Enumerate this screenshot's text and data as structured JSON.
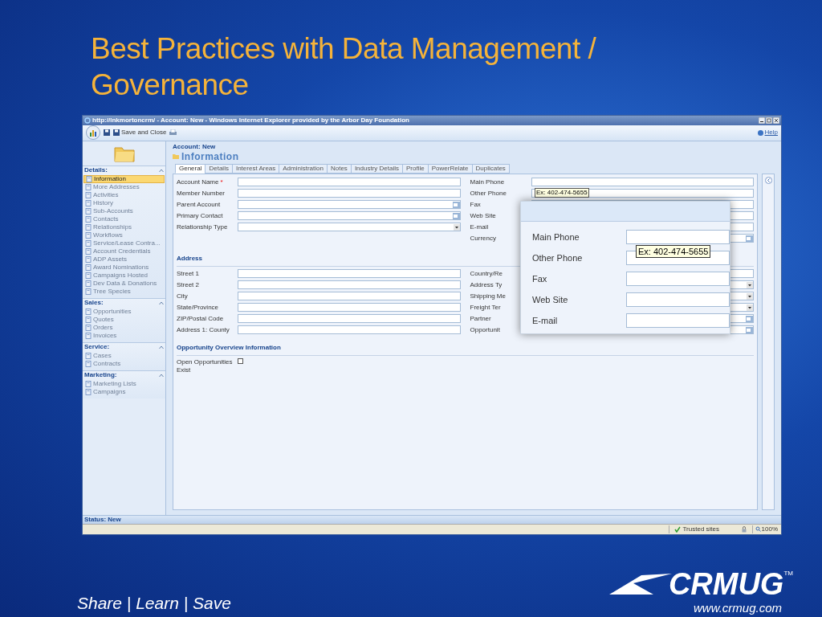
{
  "slide": {
    "title": "Best Practices with Data Management / Governance",
    "tagline": "Share | Learn | Save",
    "logo": {
      "name": "CRMUG",
      "trademark": "TM",
      "url": "www.crmug.com"
    }
  },
  "browser": {
    "title": "http://lnkmortoncrm/ - Account: New - Windows Internet Explorer provided by the Arbor Day Foundation",
    "toolbar": {
      "save_close": "Save and Close",
      "help": "Help"
    },
    "header": {
      "entity": "Account: New",
      "title": "Information"
    },
    "sidebar": [
      {
        "title": "Details:",
        "items": [
          {
            "label": "Information",
            "selected": true
          },
          {
            "label": "More Addresses",
            "selected": false
          },
          {
            "label": "Activities",
            "selected": false
          },
          {
            "label": "History",
            "selected": false
          },
          {
            "label": "Sub-Accounts",
            "selected": false
          },
          {
            "label": "Contacts",
            "selected": false
          },
          {
            "label": "Relationships",
            "selected": false
          },
          {
            "label": "Workflows",
            "selected": false
          },
          {
            "label": "Service/Lease Contra...",
            "selected": false
          },
          {
            "label": "Account Credentials",
            "selected": false
          },
          {
            "label": "ADP Assets",
            "selected": false
          },
          {
            "label": "Award Nominations",
            "selected": false
          },
          {
            "label": "Campaigns Hosted",
            "selected": false
          },
          {
            "label": "Dev Data & Donations",
            "selected": false
          },
          {
            "label": "Tree Species",
            "selected": false
          }
        ]
      },
      {
        "title": "Sales:",
        "items": [
          {
            "label": "Opportunities",
            "selected": false
          },
          {
            "label": "Quotes",
            "selected": false
          },
          {
            "label": "Orders",
            "selected": false
          },
          {
            "label": "Invoices",
            "selected": false
          }
        ]
      },
      {
        "title": "Service:",
        "items": [
          {
            "label": "Cases",
            "selected": false
          },
          {
            "label": "Contracts",
            "selected": false
          }
        ]
      },
      {
        "title": "Marketing:",
        "items": [
          {
            "label": "Marketing Lists",
            "selected": false
          },
          {
            "label": "Campaigns",
            "selected": false
          }
        ]
      }
    ],
    "tabs": [
      {
        "label": "General",
        "selected": true
      },
      {
        "label": "Details",
        "selected": false
      },
      {
        "label": "Interest Areas",
        "selected": false
      },
      {
        "label": "Administration",
        "selected": false
      },
      {
        "label": "Notes",
        "selected": false
      },
      {
        "label": "Industry Details",
        "selected": false
      },
      {
        "label": "Profile",
        "selected": false
      },
      {
        "label": "PowerRelate",
        "selected": false
      },
      {
        "label": "Duplicates",
        "selected": false
      }
    ],
    "form": {
      "left_fields": [
        {
          "label": "Account Name",
          "marker": "*",
          "kind": "text"
        },
        {
          "label": "Member Number",
          "kind": "text"
        },
        {
          "label": "Parent Account",
          "kind": "lookup"
        },
        {
          "label": "Primary Contact",
          "kind": "lookup"
        },
        {
          "label": "Relationship Type",
          "kind": "select"
        }
      ],
      "right_fields": [
        {
          "label": "Main Phone",
          "kind": "text"
        },
        {
          "label": "Other Phone",
          "kind": "text"
        },
        {
          "label": "Fax",
          "kind": "text"
        },
        {
          "label": "Web Site",
          "kind": "text"
        },
        {
          "label": "E-mail",
          "kind": "text"
        },
        {
          "label": "Currency",
          "kind": "lookup"
        }
      ],
      "address_title": "Address",
      "address_left": [
        {
          "label": "Street 1",
          "kind": "text"
        },
        {
          "label": "Street 2",
          "kind": "text"
        },
        {
          "label": "City",
          "kind": "text"
        },
        {
          "label": "State/Province",
          "kind": "text"
        },
        {
          "label": "ZIP/Postal Code",
          "kind": "text"
        },
        {
          "label": "Address 1: County",
          "kind": "text"
        }
      ],
      "address_right": [
        {
          "label": "Country/Re",
          "kind": "text"
        },
        {
          "label": "Address Ty",
          "kind": "select"
        },
        {
          "label": "Shipping Me",
          "kind": "select"
        },
        {
          "label": "Freight Ter",
          "kind": "select"
        },
        {
          "label": "Partner",
          "kind": "lookup"
        },
        {
          "label": "Opportunit",
          "kind": "lookup"
        }
      ],
      "opportunity_title": "Opportunity Overview Information",
      "checkbox": {
        "label": "Open Opportunities Exist",
        "checked": false
      },
      "tooltip": "Ex: 402-474-5655"
    },
    "magnifier": {
      "fields": [
        "Main Phone",
        "Other Phone",
        "Fax",
        "Web Site",
        "E-mail"
      ],
      "tooltip": "Ex: 402-474-5655"
    },
    "status": "Status: New",
    "statusbar": {
      "zone": "Trusted sites",
      "zoom": "100%"
    }
  }
}
